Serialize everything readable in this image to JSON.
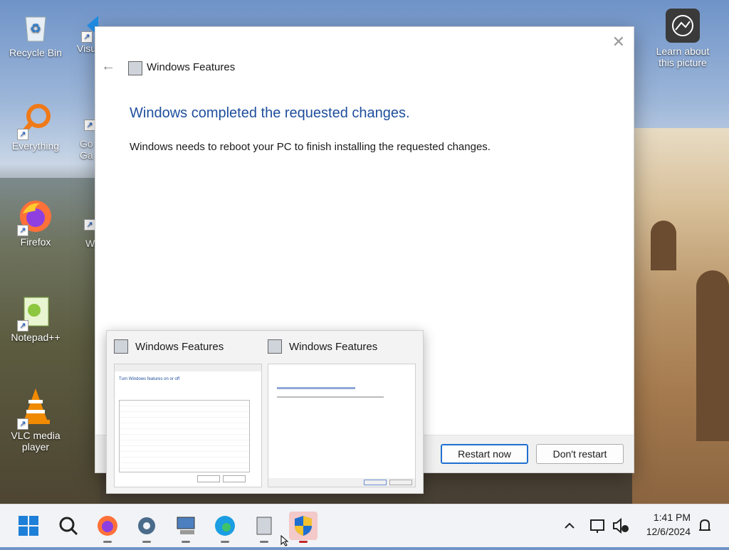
{
  "desktop": {
    "icons": [
      {
        "label": "Recycle Bin"
      },
      {
        "label": "Visu"
      },
      {
        "label": "Everything"
      },
      {
        "label": "Go Ga"
      },
      {
        "label": "Firefox"
      },
      {
        "label": "W"
      },
      {
        "label": "Notepad++"
      },
      {
        "label": "VLC media player"
      }
    ],
    "learn_about": "Learn about this picture"
  },
  "dialog": {
    "title": "Windows Features",
    "headline": "Windows completed the requested changes.",
    "message": "Windows needs to reboot your PC to finish installing the requested changes.",
    "restart_label": "Restart now",
    "dont_restart_label": "Don't restart"
  },
  "thumbnails": [
    {
      "title": "Windows Features"
    },
    {
      "title": "Windows Features"
    }
  ],
  "taskbar": {
    "time": "1:41 PM",
    "date": "12/6/2024"
  }
}
